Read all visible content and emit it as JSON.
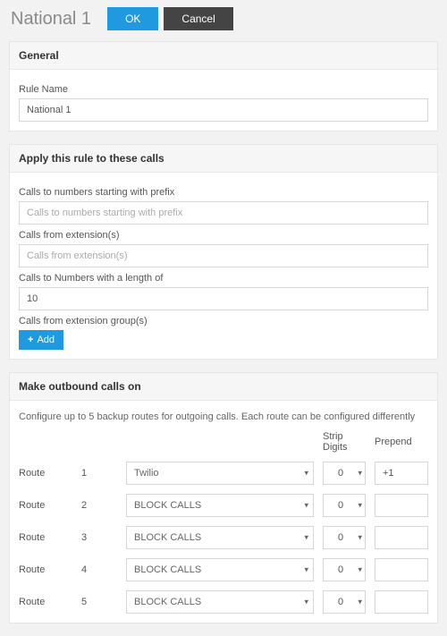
{
  "header": {
    "title": "National 1",
    "ok_label": "OK",
    "cancel_label": "Cancel"
  },
  "general": {
    "panel_title": "General",
    "rule_name_label": "Rule Name",
    "rule_name_value": "National 1"
  },
  "apply": {
    "panel_title": "Apply this rule to these calls",
    "prefix_label": "Calls to numbers starting with prefix",
    "prefix_placeholder": "Calls to numbers starting with prefix",
    "prefix_value": "",
    "from_ext_label": "Calls from extension(s)",
    "from_ext_placeholder": "Calls from extension(s)",
    "from_ext_value": "",
    "length_label": "Calls to Numbers with a length of",
    "length_value": "10",
    "ext_group_label": "Calls from extension group(s)",
    "add_label": "Add"
  },
  "outbound": {
    "panel_title": "Make outbound calls on",
    "desc": "Configure up to 5 backup routes for outgoing calls. Each route can be configured differently",
    "route_label": "Route",
    "strip_header": "Strip Digits",
    "prepend_header": "Prepend",
    "routes": [
      {
        "index": "1",
        "select": "Twilio",
        "strip": "0",
        "prepend": "+1"
      },
      {
        "index": "2",
        "select": "BLOCK CALLS",
        "strip": "0",
        "prepend": ""
      },
      {
        "index": "3",
        "select": "BLOCK CALLS",
        "strip": "0",
        "prepend": ""
      },
      {
        "index": "4",
        "select": "BLOCK CALLS",
        "strip": "0",
        "prepend": ""
      },
      {
        "index": "5",
        "select": "BLOCK CALLS",
        "strip": "0",
        "prepend": ""
      }
    ]
  }
}
